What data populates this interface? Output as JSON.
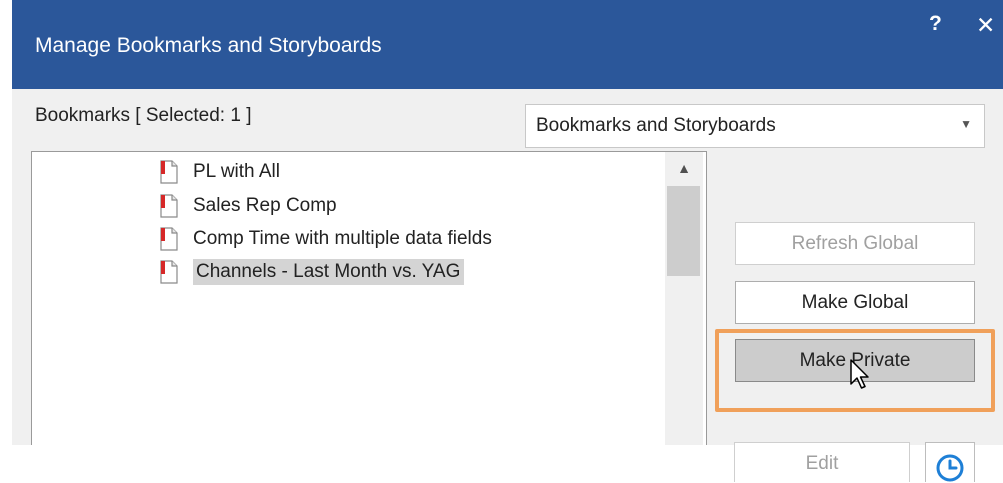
{
  "window": {
    "title": "Manage Bookmarks and Storyboards",
    "help_label": "?",
    "close_label": "✕"
  },
  "bookmarks": {
    "label": "Bookmarks [ Selected: 1 ]",
    "filter_selected": "Bookmarks and Storyboards",
    "items": [
      {
        "label": "PL with All",
        "selected": false
      },
      {
        "label": "Sales Rep Comp",
        "selected": false
      },
      {
        "label": "Comp Time with multiple data fields",
        "selected": false
      },
      {
        "label": "Channels - Last Month vs. YAG",
        "selected": true
      }
    ]
  },
  "buttons": {
    "refresh_global": "Refresh Global",
    "make_global": "Make Global",
    "make_private": "Make Private",
    "edit": "Edit"
  },
  "colors": {
    "titlebar": "#2b579a",
    "highlight": "#f0a05a",
    "clock_icon": "#1e7fd6",
    "doc_icon_accent": "#d62828"
  }
}
